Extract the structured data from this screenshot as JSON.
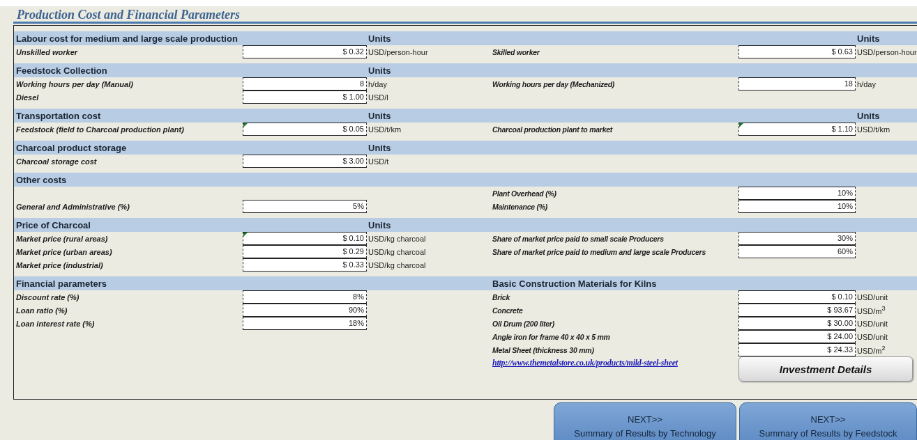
{
  "title": "Production Cost and Financial Parameters",
  "sections": [
    {
      "title": "Labour cost for medium and large scale production",
      "units": "Units",
      "right_units": "Units",
      "rows": [
        {
          "left": {
            "label": "Unskilled worker",
            "value": "$ 0.32",
            "unit": "USD/person-hour",
            "marked": false
          },
          "right": {
            "label": "Skilled worker",
            "value": "$ 0.63",
            "unit": "USD/person-hour",
            "marked": false
          }
        }
      ]
    },
    {
      "title": "Feedstock Collection",
      "units": "Units",
      "rows": [
        {
          "left": {
            "label": "Working hours per day (Manual)",
            "value": "8",
            "unit": "h/day",
            "marked": false
          },
          "right": {
            "label": "Working hours per day (Mechanized)",
            "value": "18",
            "unit": "h/day",
            "marked": false
          }
        },
        {
          "left": {
            "label": "Diesel",
            "value": "$ 1.00",
            "unit": "USD/l",
            "marked": false
          }
        }
      ]
    },
    {
      "title": "Transportation cost",
      "units": "Units",
      "right_units": "Units",
      "rows": [
        {
          "left": {
            "label": "Feedstock (field to Charcoal production plant)",
            "value": "$ 0.05",
            "unit": "USD/t/km",
            "marked": true
          },
          "right": {
            "label": "Charcoal production plant to market",
            "value": "$ 1.10",
            "unit": "USD/t/km",
            "marked": true
          }
        }
      ]
    },
    {
      "title": "Charcoal product storage",
      "units": "Units",
      "rows": [
        {
          "left": {
            "label": "Charcoal storage cost",
            "value": "$ 3.00",
            "unit": "USD/t",
            "marked": false
          }
        }
      ]
    },
    {
      "title": "Other costs",
      "rows": [
        {
          "right": {
            "label": "Plant Overhead (%)",
            "value": "10%",
            "marked": false
          }
        },
        {
          "left": {
            "label": "General and Administrative (%)",
            "value": "5%",
            "marked": false
          },
          "right": {
            "label": "Maintenance (%)",
            "value": "10%",
            "marked": false
          }
        }
      ]
    },
    {
      "title": "Price of Charcoal",
      "units": "Units",
      "rows": [
        {
          "left": {
            "label": "Market price (rural areas)",
            "value": "$ 0.10",
            "unit": "USD/kg charcoal",
            "marked": true
          },
          "right": {
            "label": "Share of market price paid to small scale Producers",
            "value": "30%",
            "marked": false
          }
        },
        {
          "left": {
            "label": "Market price (urban areas)",
            "value": "$ 0.29",
            "unit": "USD/kg charcoal",
            "marked": false
          },
          "right": {
            "label": "Share of market price paid to medium and large scale Producers",
            "value": "60%",
            "marked": false
          }
        },
        {
          "left": {
            "label": "Market price (industrial)",
            "value": "$ 0.33",
            "unit": "USD/kg charcoal",
            "marked": false
          }
        }
      ]
    },
    {
      "title": "Financial parameters",
      "right_title": "Basic Construction Materials for Kilns",
      "rows": [
        {
          "left": {
            "label": "Discount rate (%)",
            "value": "8%",
            "marked": false
          },
          "right": {
            "label": "Brick",
            "value": "$ 0.10",
            "unit": "USD/unit",
            "marked": false
          }
        },
        {
          "left": {
            "label": "Loan ratio (%)",
            "value": "90%",
            "marked": false
          },
          "right": {
            "label": "Concrete",
            "value": "$ 93.67",
            "unit": "USD/m$^{3}$",
            "marked": false
          }
        },
        {
          "left": {
            "label": "Loan interest rate (%)",
            "value": "18%",
            "marked": false
          },
          "right": {
            "label": "Oil Drum (200 liter)",
            "value": "$ 30.00",
            "unit": "USD/unit",
            "marked": false
          }
        },
        {
          "right": {
            "label": "Angle iron for frame 40 x 40 x 5 mm",
            "value": "$ 24.00",
            "unit": "USD/unit",
            "marked": false
          }
        },
        {
          "right": {
            "label": "Metal Sheet (thickness 30 mm)",
            "value": "$ 24.33",
            "unit": "USD/m$^{2}$",
            "marked": false
          }
        }
      ],
      "link": "http://www.themetalstore.co.uk/products/mild-steel-sheet",
      "button": "Investment Details"
    }
  ],
  "nav_buttons": [
    {
      "line1": "NEXT>>",
      "line2": "Summary of Results by Technology"
    },
    {
      "line1": "NEXT>>",
      "line2": "Summary of Results by Feedstock"
    }
  ]
}
